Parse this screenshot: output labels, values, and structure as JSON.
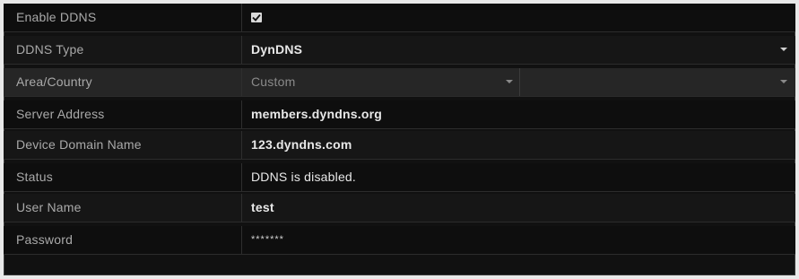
{
  "form": {
    "enable_ddns": {
      "label": "Enable DDNS",
      "checked": true
    },
    "ddns_type": {
      "label": "DDNS Type",
      "value": "DynDNS"
    },
    "area_country": {
      "label": "Area/Country",
      "value": "Custom"
    },
    "server_address": {
      "label": "Server Address",
      "value": "members.dyndns.org"
    },
    "device_domain_name": {
      "label": "Device Domain Name",
      "value": "123.dyndns.com"
    },
    "status": {
      "label": "Status",
      "value": "DDNS is disabled."
    },
    "user_name": {
      "label": "User Name",
      "value": "test"
    },
    "password": {
      "label": "Password",
      "value": "*******"
    }
  },
  "icons": {
    "checkbox": "checkmark-icon",
    "dropdown": "dropdown-arrow-icon"
  }
}
